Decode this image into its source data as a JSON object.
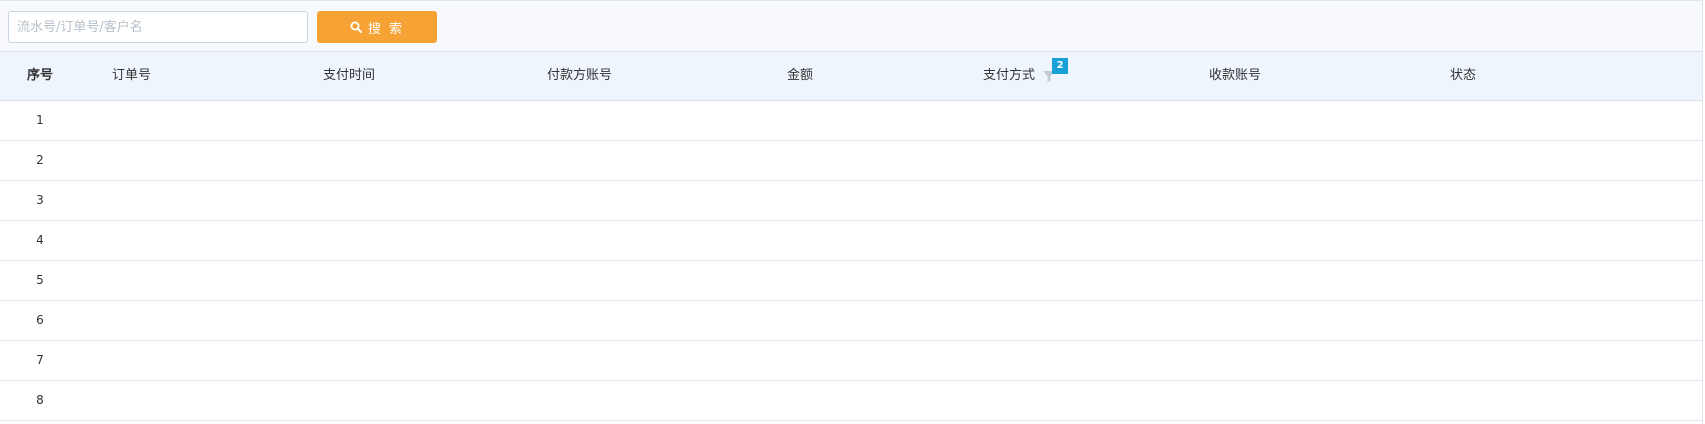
{
  "search": {
    "placeholder": "流水号/订单号/客户名",
    "value": "",
    "button_label": "搜 索"
  },
  "table": {
    "headers": {
      "index": "序号",
      "order_no": "订单号",
      "pay_time": "支付时间",
      "payer_account": "付款方账号",
      "amount": "金额",
      "pay_method": "支付方式",
      "payee_account": "收款账号",
      "status": "状态"
    },
    "pay_method_filter_count": "2",
    "rows": [
      {
        "index": "1"
      },
      {
        "index": "2"
      },
      {
        "index": "3"
      },
      {
        "index": "4"
      },
      {
        "index": "5"
      },
      {
        "index": "6"
      },
      {
        "index": "7"
      },
      {
        "index": "8"
      }
    ]
  },
  "colors": {
    "accent": "#f7a234",
    "badge": "#1aa0d8",
    "header_bg": "#eef5fd"
  }
}
